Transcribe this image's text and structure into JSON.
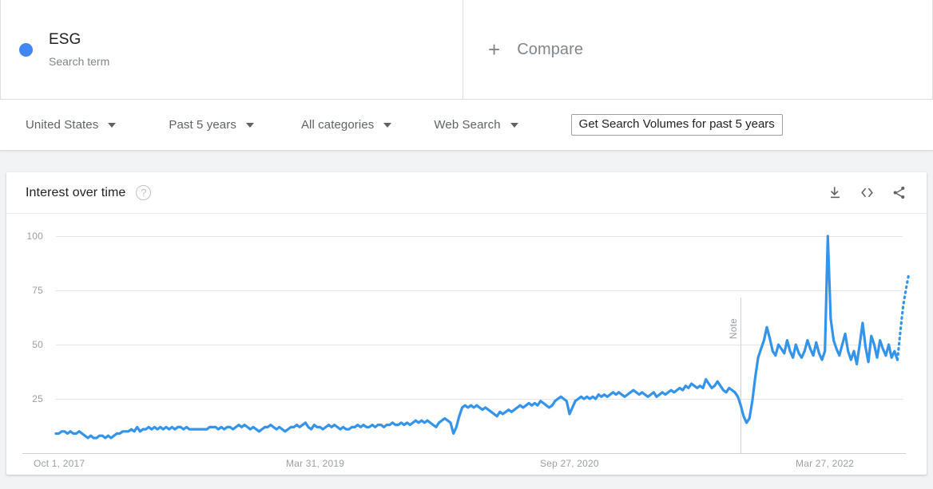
{
  "terms": [
    {
      "label": "ESG",
      "type_label": "Search term",
      "color": "#4285f4"
    }
  ],
  "compare": {
    "plus_glyph": "+",
    "label": "Compare"
  },
  "filters": [
    {
      "name": "region",
      "label": "United States"
    },
    {
      "name": "time-range",
      "label": "Past 5 years"
    },
    {
      "name": "category",
      "label": "All categories"
    },
    {
      "name": "search-type",
      "label": "Web Search"
    }
  ],
  "actions": {
    "get_volumes_label": "Get Search Volumes for past 5 years"
  },
  "card": {
    "title": "Interest over time",
    "help_glyph": "?",
    "icons": [
      {
        "name": "download-icon"
      },
      {
        "name": "embed-code-icon"
      },
      {
        "name": "share-icon"
      }
    ]
  },
  "chart_data": {
    "type": "line",
    "title": "Interest over time",
    "xlabel": "",
    "ylabel": "",
    "ylim": [
      0,
      100
    ],
    "yticks": [
      25,
      50,
      75,
      100
    ],
    "xticks": [
      "Oct 1, 2017",
      "Mar 31, 2019",
      "Sep 27, 2020",
      "Mar 27, 2022"
    ],
    "grid": true,
    "legend": "none",
    "line_color": "#3494ec",
    "annotations": [
      {
        "label": "Note",
        "x_index": 236
      }
    ],
    "partial_data_tail": true,
    "series": [
      {
        "name": "ESG",
        "values": [
          9,
          9,
          10,
          10,
          9,
          10,
          9,
          9,
          10,
          9,
          8,
          7,
          8,
          7,
          7,
          8,
          8,
          7,
          8,
          7,
          8,
          9,
          9,
          10,
          10,
          10,
          11,
          10,
          12,
          10,
          11,
          11,
          12,
          11,
          12,
          11,
          12,
          11,
          12,
          11,
          12,
          11,
          12,
          12,
          11,
          12,
          11,
          11,
          11,
          11,
          11,
          11,
          11,
          12,
          12,
          12,
          11,
          12,
          11,
          12,
          12,
          11,
          12,
          13,
          12,
          13,
          12,
          11,
          12,
          11,
          10,
          11,
          12,
          12,
          13,
          12,
          11,
          12,
          11,
          10,
          11,
          12,
          12,
          13,
          12,
          13,
          14,
          12,
          11,
          13,
          12,
          12,
          11,
          12,
          13,
          12,
          13,
          12,
          11,
          12,
          11,
          11,
          12,
          12,
          13,
          12,
          13,
          12,
          12,
          13,
          12,
          13,
          13,
          12,
          13,
          13,
          14,
          13,
          13,
          14,
          13,
          14,
          13,
          14,
          15,
          14,
          15,
          14,
          15,
          14,
          13,
          12,
          14,
          15,
          16,
          15,
          14,
          9,
          12,
          17,
          21,
          22,
          21,
          22,
          21,
          22,
          21,
          20,
          21,
          20,
          19,
          18,
          17,
          19,
          18,
          19,
          20,
          19,
          20,
          21,
          22,
          21,
          22,
          23,
          22,
          23,
          22,
          24,
          23,
          22,
          21,
          22,
          24,
          25,
          26,
          25,
          24,
          18,
          21,
          24,
          25,
          26,
          25,
          26,
          25,
          26,
          25,
          27,
          26,
          27,
          26,
          27,
          28,
          27,
          28,
          27,
          26,
          27,
          28,
          29,
          28,
          27,
          28,
          27,
          26,
          27,
          28,
          26,
          27,
          28,
          27,
          28,
          29,
          28,
          29,
          30,
          29,
          31,
          30,
          32,
          31,
          30,
          31,
          30,
          34,
          32,
          30,
          31,
          33,
          31,
          29,
          28,
          30,
          29,
          28,
          26,
          22,
          17,
          14,
          16,
          24,
          35,
          44,
          48,
          52,
          58,
          53,
          47,
          45,
          50,
          48,
          46,
          52,
          47,
          44,
          50,
          46,
          44,
          47,
          52,
          48,
          45,
          51,
          46,
          43,
          47,
          100,
          62,
          52,
          48,
          45,
          50,
          55,
          47,
          43,
          47,
          41,
          50,
          60,
          49,
          42,
          54,
          50,
          44,
          52,
          48,
          45,
          50,
          44,
          47,
          43,
          56,
          68,
          76,
          83
        ]
      }
    ]
  }
}
